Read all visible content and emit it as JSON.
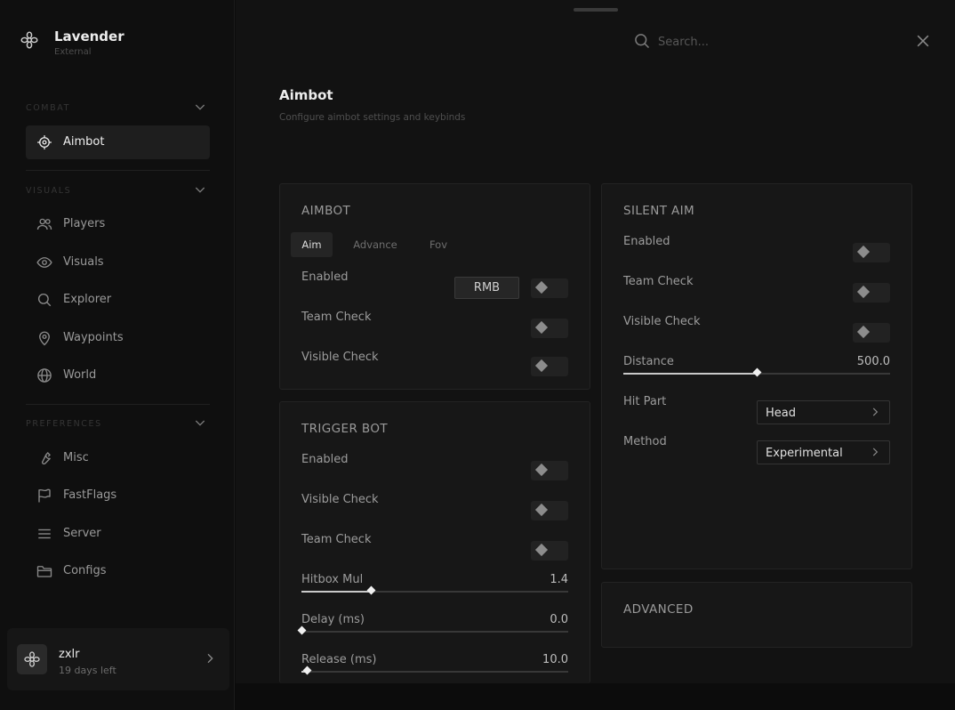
{
  "brand": {
    "name": "Lavender",
    "subtitle": "External"
  },
  "sidebar": {
    "sections": [
      {
        "title": "COMBAT",
        "items": [
          {
            "label": "Aimbot",
            "icon": "crosshair-icon",
            "active": true
          }
        ]
      },
      {
        "title": "VISUALS",
        "items": [
          {
            "label": "Players",
            "icon": "users-icon"
          },
          {
            "label": "Visuals",
            "icon": "eye-icon"
          },
          {
            "label": "Explorer",
            "icon": "search-icon"
          },
          {
            "label": "Waypoints",
            "icon": "map-pin-icon"
          },
          {
            "label": "World",
            "icon": "globe-icon"
          }
        ]
      },
      {
        "title": "PREFERENCES",
        "items": [
          {
            "label": "Misc",
            "icon": "wrench-icon"
          },
          {
            "label": "FastFlags",
            "icon": "flag-icon"
          },
          {
            "label": "Server",
            "icon": "menu-icon"
          },
          {
            "label": "Configs",
            "icon": "folder-icon"
          }
        ]
      }
    ]
  },
  "user": {
    "name": "zxlr",
    "subscription": "19 days left"
  },
  "search": {
    "placeholder": "Search..."
  },
  "page": {
    "title": "Aimbot",
    "subtitle": "Configure aimbot settings and keybinds"
  },
  "aimbot_card": {
    "title": "AIMBOT",
    "tabs": [
      {
        "label": "Aim",
        "active": true
      },
      {
        "label": "Advance"
      },
      {
        "label": "Fov"
      }
    ],
    "rows": [
      {
        "label": "Enabled",
        "keybind": "RMB"
      },
      {
        "label": "Team Check"
      },
      {
        "label": "Visible Check"
      }
    ]
  },
  "triggerbot_card": {
    "title": "TRIGGER BOT",
    "rows": [
      {
        "label": "Enabled"
      },
      {
        "label": "Visible Check"
      },
      {
        "label": "Team Check"
      }
    ],
    "sliders": [
      {
        "label": "Hitbox Mul",
        "value": "1.4",
        "fraction": 0.26
      },
      {
        "label": "Delay (ms)",
        "value": "0.0",
        "fraction": 0.0
      },
      {
        "label": "Release (ms)",
        "value": "10.0",
        "fraction": 0.02
      }
    ]
  },
  "silentaim_card": {
    "title": "SILENT AIM",
    "rows": [
      {
        "label": "Enabled"
      },
      {
        "label": "Team Check"
      },
      {
        "label": "Visible Check"
      }
    ],
    "slider": {
      "label": "Distance",
      "value": "500.0",
      "fraction": 0.5
    },
    "selects": [
      {
        "label": "Hit Part",
        "value": "Head"
      },
      {
        "label": "Method",
        "value": "Experimental"
      }
    ]
  },
  "advanced_card": {
    "title": "ADVANCED"
  },
  "colors": {
    "background": "#121212",
    "sidebar": "#0f0f0f",
    "card": "#171717",
    "accent": "#e8e8e8"
  }
}
